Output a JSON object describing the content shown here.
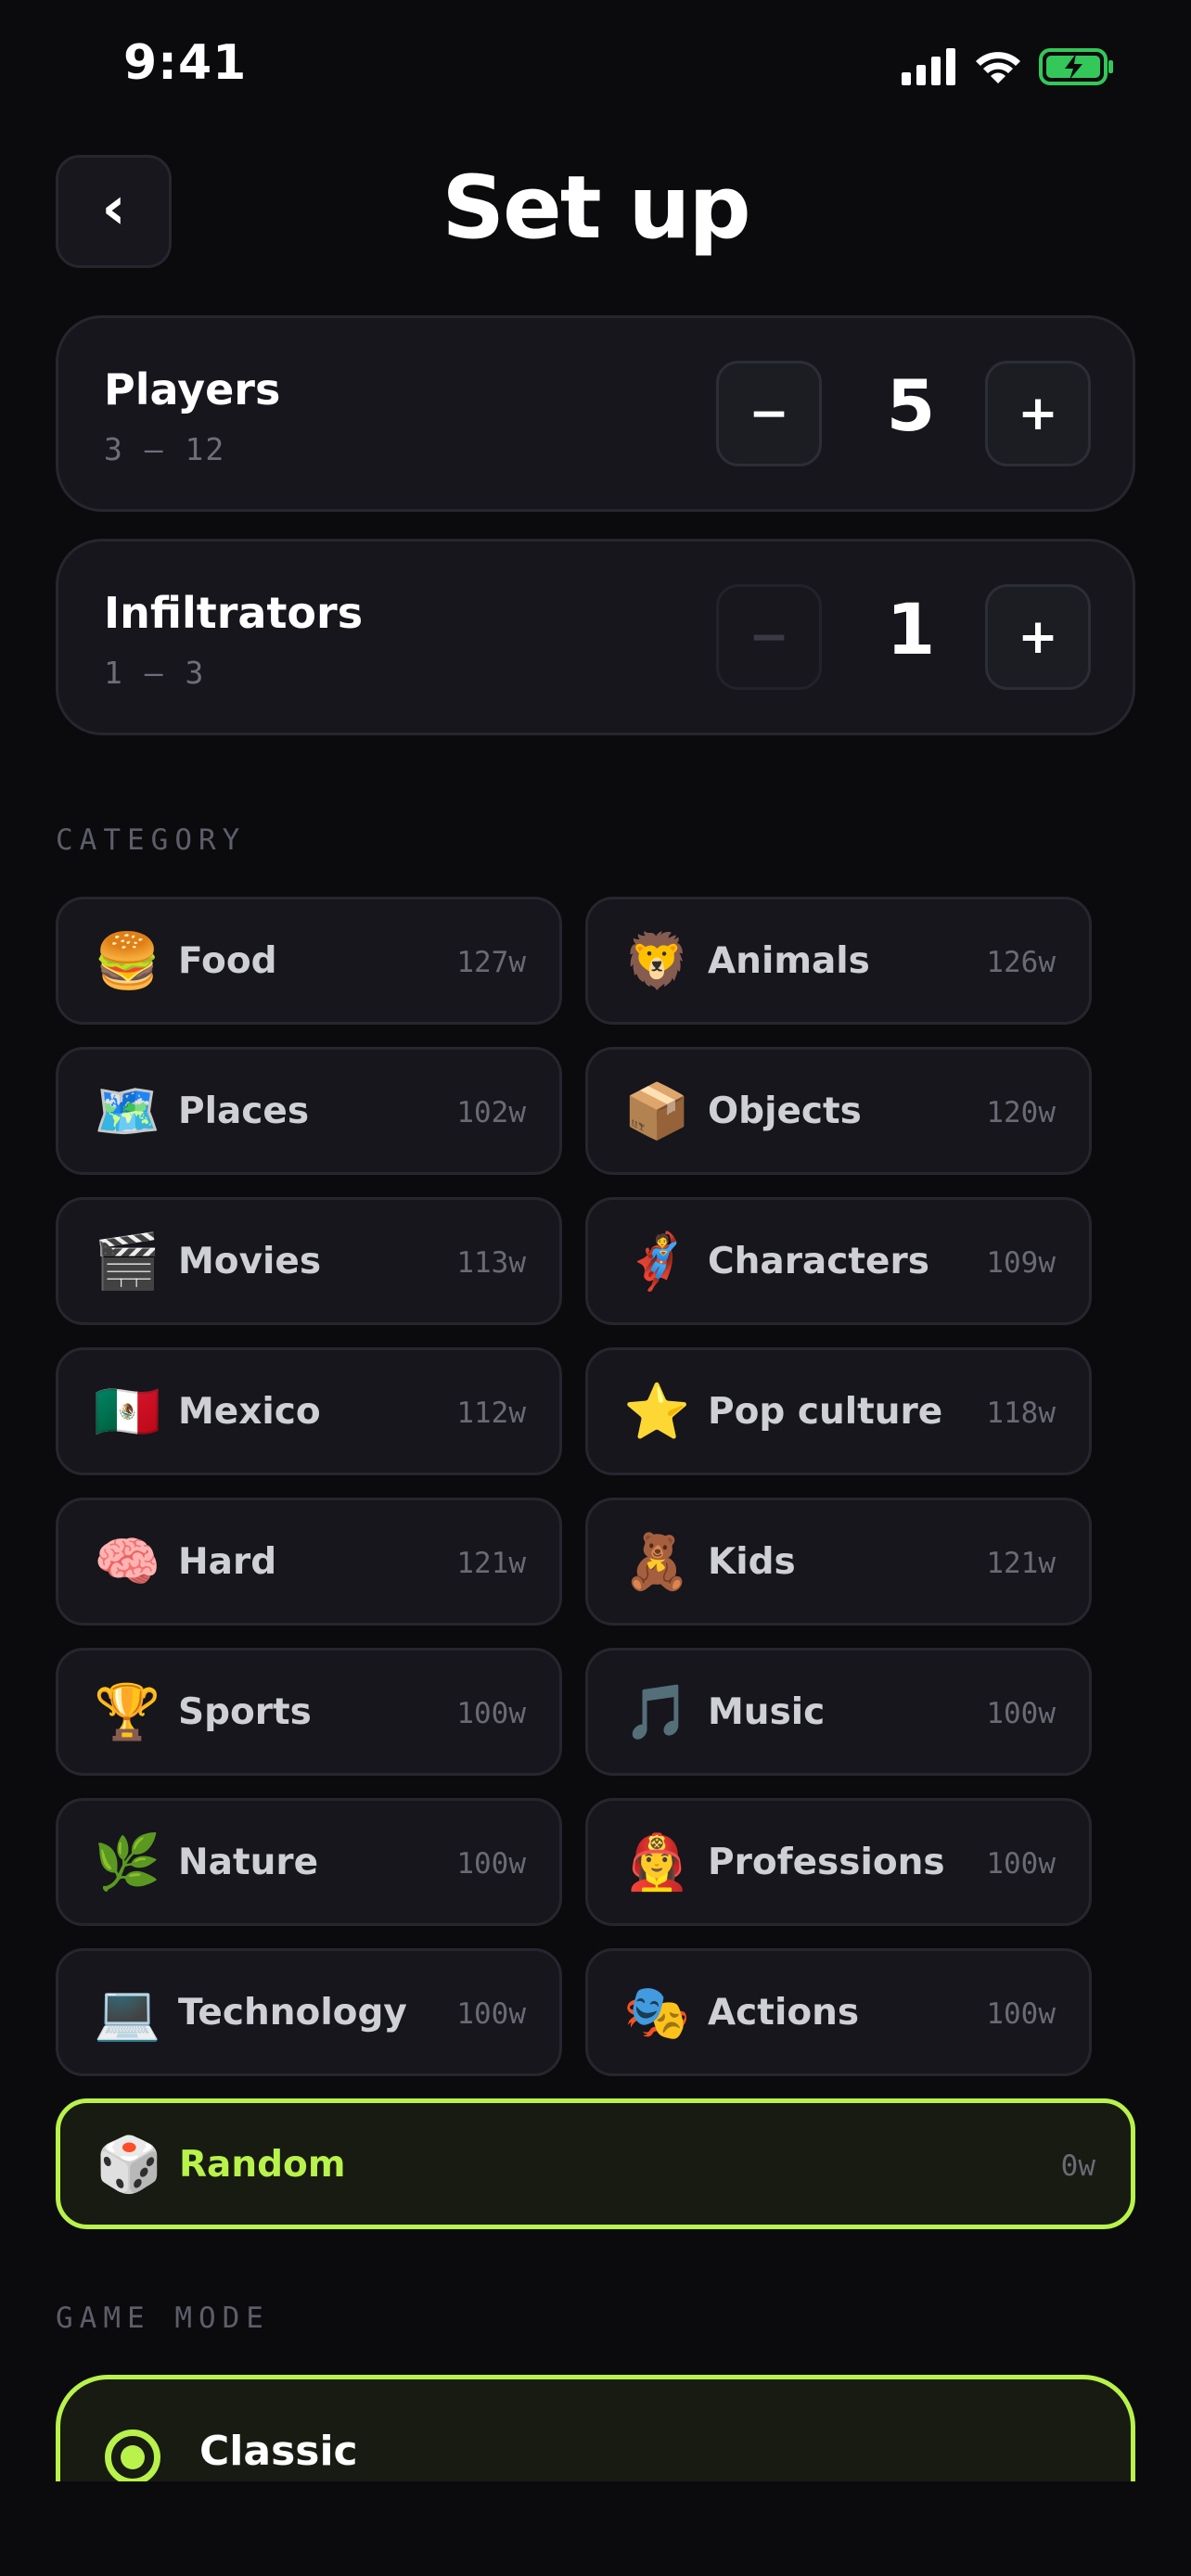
{
  "status_bar": {
    "time": "9:41"
  },
  "header": {
    "title": "Set up",
    "back_glyph": "‹"
  },
  "players": {
    "label": "Players",
    "range": "3 – 12",
    "value": "5",
    "minus": "−",
    "plus": "+"
  },
  "infiltrators": {
    "label": "Infiltrators",
    "range": "1 – 3",
    "value": "1",
    "minus": "−",
    "plus": "+",
    "minus_disabled": true
  },
  "category_section": {
    "title": "CATEGORY"
  },
  "categories": [
    {
      "emoji": "🍔",
      "label": "Food",
      "count": "127w"
    },
    {
      "emoji": "🦁",
      "label": "Animals",
      "count": "126w"
    },
    {
      "emoji": "🗺️",
      "label": "Places",
      "count": "102w"
    },
    {
      "emoji": "📦",
      "label": "Objects",
      "count": "120w"
    },
    {
      "emoji": "🎬",
      "label": "Movies",
      "count": "113w"
    },
    {
      "emoji": "🦸",
      "label": "Characters",
      "count": "109w"
    },
    {
      "emoji": "🇲🇽",
      "label": "Mexico",
      "count": "112w"
    },
    {
      "emoji": "⭐",
      "label": "Pop culture",
      "count": "118w"
    },
    {
      "emoji": "🧠",
      "label": "Hard",
      "count": "121w"
    },
    {
      "emoji": "🧸",
      "label": "Kids",
      "count": "121w"
    },
    {
      "emoji": "🏆",
      "label": "Sports",
      "count": "100w"
    },
    {
      "emoji": "🎵",
      "label": "Music",
      "count": "100w"
    },
    {
      "emoji": "🌿",
      "label": "Nature",
      "count": "100w"
    },
    {
      "emoji": "👩‍🚒",
      "label": "Professions",
      "count": "100w"
    },
    {
      "emoji": "💻",
      "label": "Technology",
      "count": "100w"
    },
    {
      "emoji": "🎭",
      "label": "Actions",
      "count": "100w"
    }
  ],
  "random": {
    "emoji": "🎲",
    "label": "Random",
    "count": "0w",
    "selected": true
  },
  "game_mode_section": {
    "title": "GAME MODE"
  },
  "game_modes": [
    {
      "label": "Classic",
      "selected": true
    }
  ],
  "colors": {
    "accent": "#b8f24a",
    "background": "#0b0b0e",
    "card": "#16161c",
    "battery_fill": "#34c759"
  }
}
